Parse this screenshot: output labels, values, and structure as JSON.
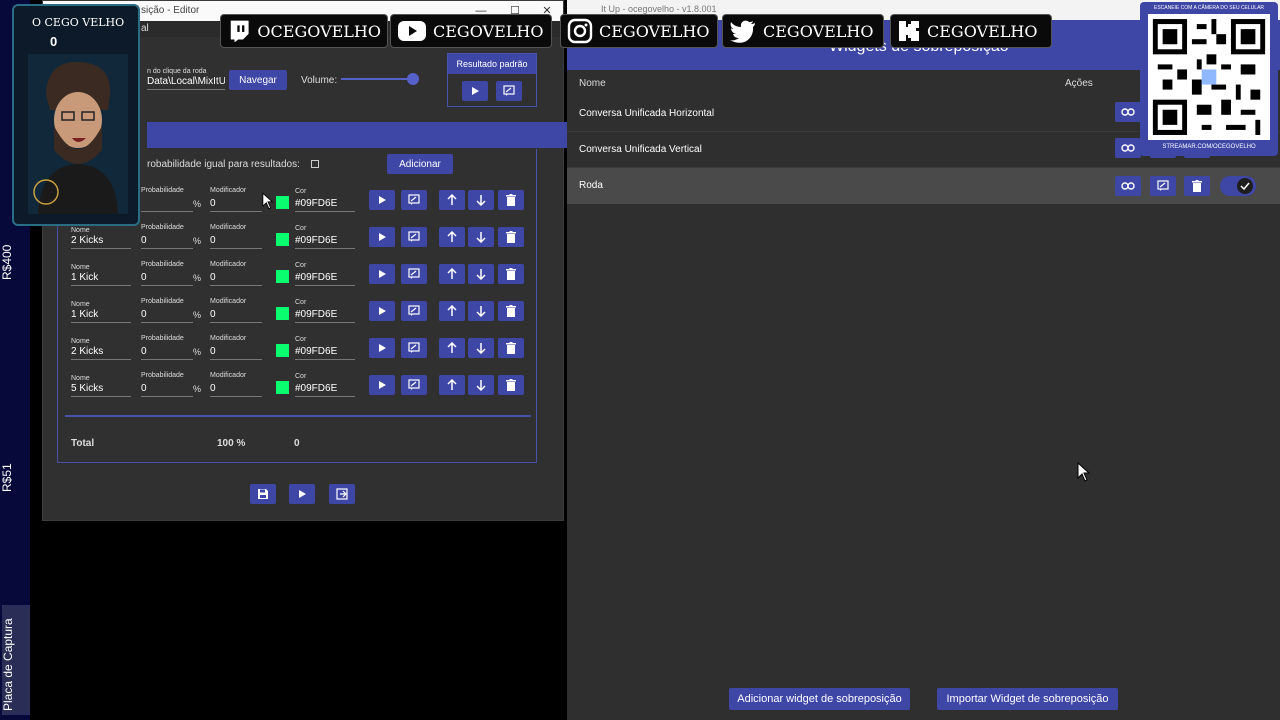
{
  "left_strip": {
    "labels": [
      "R$400",
      "R$51",
      "Placa de Captura"
    ]
  },
  "editor": {
    "title": "sição - Editor",
    "menu_item": "al",
    "path_label": "n do clique da roda",
    "path_value": "Data\\Local\\MixItU",
    "browse_label": "Navegar",
    "volume_label": "Volume:",
    "volume_level": 0.95,
    "default_result_label": "Resultado padrão",
    "equal_prob_label": "robabilidade igual para resultados:",
    "add_label": "Adicionar",
    "headers": {
      "name": "Nome",
      "probability": "Probabilidade",
      "modifier": "Modificador",
      "color": "Cor",
      "percent": "%"
    },
    "rows": [
      {
        "name": "",
        "probability": "",
        "modifier": "0",
        "color": "#09FD6E"
      },
      {
        "name": "2 Kicks",
        "probability": "0",
        "modifier": "0",
        "color": "#09FD6E"
      },
      {
        "name": "1 Kick",
        "probability": "0",
        "modifier": "0",
        "color": "#09FD6E"
      },
      {
        "name": "1 Kick",
        "probability": "0",
        "modifier": "0",
        "color": "#09FD6E"
      },
      {
        "name": "2 Kicks",
        "probability": "0",
        "modifier": "0",
        "color": "#09FD6E"
      },
      {
        "name": "5 Kicks",
        "probability": "0",
        "modifier": "0",
        "color": "#09FD6E"
      }
    ],
    "total": {
      "label": "Total",
      "percent": "100 %",
      "modifier": "0"
    }
  },
  "widgets": {
    "title": "Widgets de sobreposição",
    "columns": {
      "name": "Nome",
      "actions": "Ações"
    },
    "items": [
      {
        "name": "Conversa Unificada Horizontal"
      },
      {
        "name": "Conversa Unificada Vertical"
      },
      {
        "name": "Roda"
      }
    ],
    "add_button": "Adicionar widget de sobreposição",
    "import_button": "Importar Widget de sobreposição",
    "version": "It Up - ocegovelho - v1.8.001"
  },
  "social": [
    {
      "icon": "twitch-icon",
      "handle": "OCEGOVELHO"
    },
    {
      "icon": "youtube-icon",
      "handle": "CEGOVELHO"
    },
    {
      "icon": "instagram-icon",
      "handle": "CEGOVELHO"
    },
    {
      "icon": "twitter-icon",
      "handle": "CEGOVELHO"
    },
    {
      "icon": "kick-icon",
      "handle": "CEGOVELHO"
    }
  ],
  "qr": {
    "caption": "ESCANEIE COM A CÂMERA DO SEU CELULAR",
    "url": "STREAMAR.COM/OCEGOVELHO"
  },
  "streamer": {
    "name": "O CEGO VELHO",
    "count": "0"
  },
  "colors": {
    "accent": "#3e46a6",
    "swatch": "#09fd6e",
    "bg": "#303030"
  }
}
